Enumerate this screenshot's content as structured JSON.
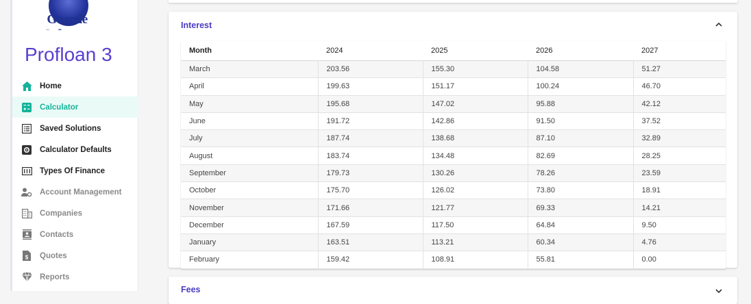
{
  "sidebar": {
    "logo_text": "Guarde Software",
    "app_title": "Profloan 3",
    "items": [
      {
        "label": "Home",
        "icon": "home-icon"
      },
      {
        "label": "Calculator",
        "icon": "calculator-icon"
      },
      {
        "label": "Saved Solutions",
        "icon": "list-icon"
      },
      {
        "label": "Calculator Defaults",
        "icon": "settings-box-icon"
      },
      {
        "label": "Types Of Finance",
        "icon": "finance-icon"
      },
      {
        "label": "Account Management",
        "icon": "account-management-icon"
      },
      {
        "label": "Companies",
        "icon": "building-icon"
      },
      {
        "label": "Contacts",
        "icon": "contacts-icon"
      },
      {
        "label": "Quotes",
        "icon": "quote-icon"
      },
      {
        "label": "Reports",
        "icon": "reports-icon"
      }
    ],
    "active_color": "#14b39a"
  },
  "interest": {
    "title": "Interest",
    "columns": [
      "Month",
      "2024",
      "2025",
      "2026",
      "2027"
    ],
    "rows": [
      [
        "March",
        "203.56",
        "155.30",
        "104.58",
        "51.27"
      ],
      [
        "April",
        "199.63",
        "151.17",
        "100.24",
        "46.70"
      ],
      [
        "May",
        "195.68",
        "147.02",
        "95.88",
        "42.12"
      ],
      [
        "June",
        "191.72",
        "142.86",
        "91.50",
        "37.52"
      ],
      [
        "July",
        "187.74",
        "138.68",
        "87.10",
        "32.89"
      ],
      [
        "August",
        "183.74",
        "134.48",
        "82.69",
        "28.25"
      ],
      [
        "September",
        "179.73",
        "130.26",
        "78.26",
        "23.59"
      ],
      [
        "October",
        "175.70",
        "126.02",
        "73.80",
        "18.91"
      ],
      [
        "November",
        "171.66",
        "121.77",
        "69.33",
        "14.21"
      ],
      [
        "December",
        "167.59",
        "117.50",
        "64.84",
        "9.50"
      ],
      [
        "January",
        "163.51",
        "113.21",
        "60.34",
        "4.76"
      ],
      [
        "February",
        "159.42",
        "108.91",
        "55.81",
        "0.00"
      ]
    ]
  },
  "fees": {
    "title": "Fees"
  }
}
